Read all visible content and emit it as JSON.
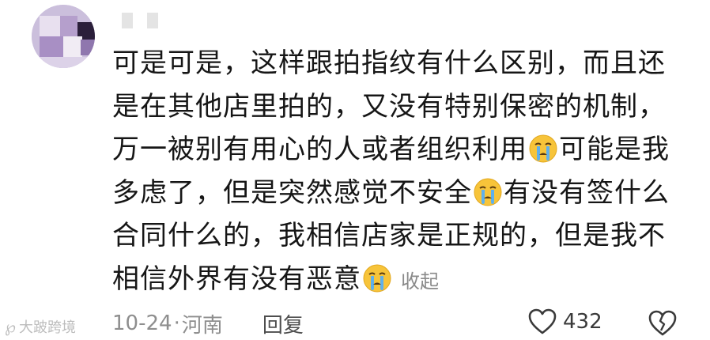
{
  "comment": {
    "lines": [
      "可是可是，这样跟拍指纹有什么区别，而且还",
      "是在其他店里拍的，又没有特别保密的机制，",
      "万一被别有用心的人或者组织利用",
      "可能是我",
      "多虑了，但是突然感觉不安全",
      "有没有签什么",
      "合同什么的，我相信店家是正规的，但是我不",
      "相信外界有没有恶意"
    ],
    "collapse_label": "收起",
    "emoji": "crying-face-icon"
  },
  "meta": {
    "date": "10-24",
    "separator": "·",
    "location": "河南",
    "reply_label": "回复"
  },
  "likes": {
    "count": "432"
  },
  "watermark": {
    "text": "大跛跨境"
  },
  "colors": {
    "text": "#161616",
    "meta": "#8e8e8e",
    "collapse": "#8a8a8a",
    "emoji_face": "#f7c43a",
    "emoji_tear": "#5fb0ec"
  }
}
